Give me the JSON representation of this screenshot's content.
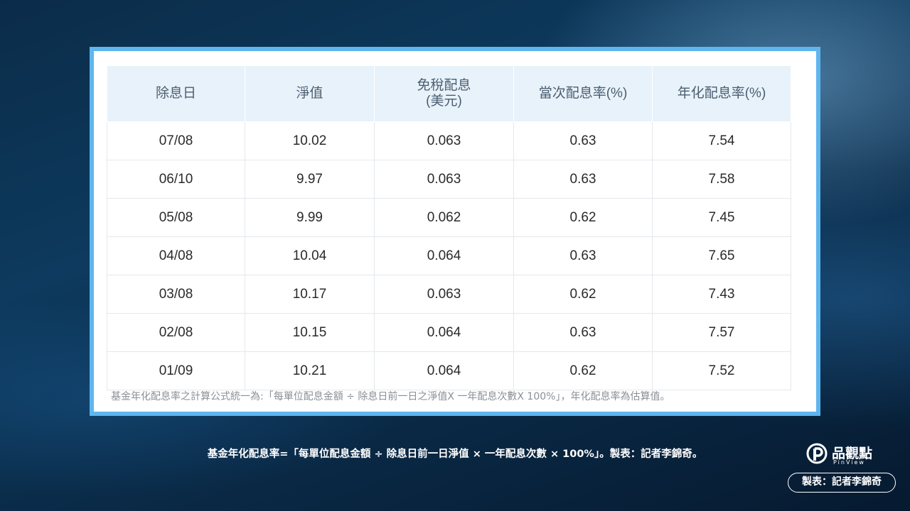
{
  "table": {
    "headers": [
      "除息日",
      "淨值",
      "免稅配息\n(美元)",
      "當次配息率(%)",
      "年化配息率(%)"
    ],
    "rows": [
      [
        "07/08",
        "10.02",
        "0.063",
        "0.63",
        "7.54"
      ],
      [
        "06/10",
        "9.97",
        "0.063",
        "0.63",
        "7.58"
      ],
      [
        "05/08",
        "9.99",
        "0.062",
        "0.62",
        "7.45"
      ],
      [
        "04/08",
        "10.04",
        "0.064",
        "0.63",
        "7.65"
      ],
      [
        "03/08",
        "10.17",
        "0.063",
        "0.62",
        "7.43"
      ],
      [
        "02/08",
        "10.15",
        "0.064",
        "0.63",
        "7.57"
      ],
      [
        "01/09",
        "10.21",
        "0.064",
        "0.62",
        "7.52"
      ]
    ],
    "note": "基金年化配息率之計算公式統一為:「每單位配息金額 ÷ 除息日前一日之淨值X 一年配息次數X 100%」，年化配息率為估算值。"
  },
  "caption": "基金年化配息率=「每單位配息金額 ÷ 除息日前一日淨值 × 一年配息次數 × 100%」。製表：記者李錦奇。",
  "brand": {
    "name": "品觀點",
    "sub": "PinView"
  },
  "credit": "製表：記者李錦奇",
  "colors": {
    "frame": "#5fb6ee",
    "header_bg": "#e8f2fa"
  }
}
